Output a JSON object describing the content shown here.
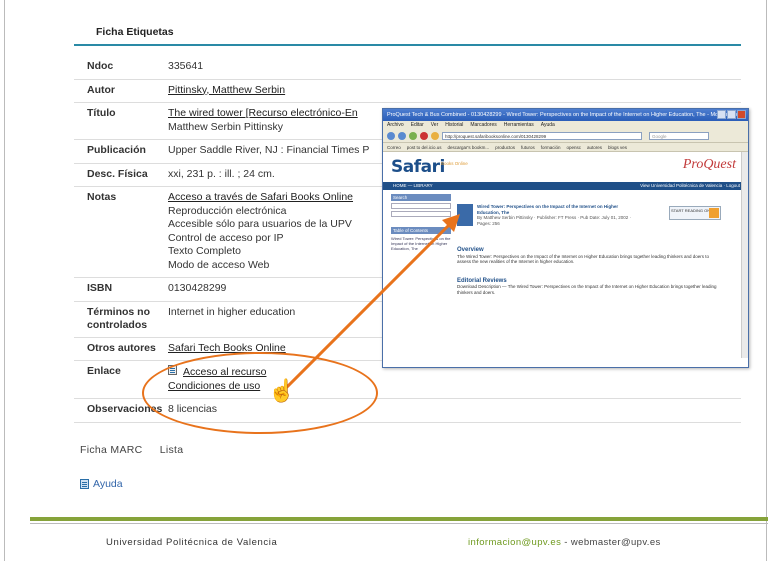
{
  "ficha": {
    "title": "Ficha Etiquetas"
  },
  "record": [
    {
      "key": "Ndoc",
      "values": [
        "335641"
      ],
      "link": [
        false
      ]
    },
    {
      "key": "Autor",
      "values": [
        "Pittinsky, Matthew Serbin"
      ],
      "link": [
        true
      ]
    },
    {
      "key": "Título",
      "values": [
        "The wired tower [Recurso electrónico-En",
        "Matthew Serbin Pittinsky"
      ],
      "link": [
        true,
        false
      ]
    },
    {
      "key": "Publicación",
      "values": [
        "Upper Saddle River, NJ : Financial Times P"
      ],
      "link": [
        false
      ]
    },
    {
      "key": "Desc. Física",
      "values": [
        "xxi, 231 p. : ill. ; 24 cm."
      ],
      "link": [
        false
      ]
    },
    {
      "key": "Notas",
      "values": [
        "Acceso a través de Safari Books Online",
        "Reproducción electrónica",
        "Accesible sólo para usuarios de la UPV",
        "Control de acceso por IP",
        "Texto Completo",
        "Modo de acceso Web"
      ],
      "link": [
        true,
        false,
        false,
        false,
        false,
        false
      ]
    },
    {
      "key": "ISBN",
      "values": [
        "0130428299"
      ],
      "link": [
        false
      ]
    },
    {
      "key": "Términos no controlados",
      "values": [
        "Internet in higher education"
      ],
      "link": [
        false
      ]
    },
    {
      "key": "Otros autores",
      "values": [
        "Safari Tech Books Online"
      ],
      "link": [
        true
      ]
    },
    {
      "key": "Enlace",
      "values": [
        "Acceso al recurso",
        "Condiciones de uso"
      ],
      "link": [
        true,
        true
      ]
    },
    {
      "key": "Observaciones",
      "values": [
        "8 licencias"
      ],
      "link": [
        false
      ]
    }
  ],
  "bottom_links": {
    "marc": "Ficha MARC",
    "lista": "Lista",
    "ayuda": "Ayuda"
  },
  "footer": {
    "university": "Universidad Politécnica de Valencia",
    "email1": "informacion@upv.es",
    "separator": " - ",
    "email2": "webmaster@upv.es"
  },
  "browser": {
    "title": "ProQuest Tech & Bus Combined - 0130428299 - Wired Tower: Perspectives on the Impact of the Internet on Higher Education, The - Mozilla Firefox",
    "menu": [
      "Archivo",
      "Editar",
      "Ver",
      "Historial",
      "Marcadores",
      "Herramientas",
      "Ayuda"
    ],
    "url": "http://proquest.safaribooksonline.com/0130428299",
    "search_placeholder": "Google",
    "bookmarks": [
      "Correo",
      "post to del.icio.us",
      "descargar's bookm...",
      "productos",
      "futuros",
      "formación",
      "opensc",
      "autores",
      "blogs ves"
    ],
    "logo": "Safari",
    "logo_sub": "Books Online",
    "brand": "ProQuest",
    "nav_left": "HOME  —  LIBRARY",
    "nav_right": "View Universidad Politécnica de Valencia  ·  Logout",
    "search_head": "Search",
    "toc_head": "Table of Contents",
    "book_title": "Wired Tower: Perspectives on the Impact of the Internet on Higher Education, The",
    "book_meta": "By Matthew Serbin Pittinsky · Publisher: FT Press · Pub Date: July 01, 2002 · Pages: 256",
    "start_reading": "START READING ONLINE",
    "overview_head": "Overview",
    "overview_text": "The Wired Tower: Perspectives on the Impact of the Internet on Higher Education brings together leading thinkers and doers to assess the new realities of the Internet in higher education.",
    "reviews_head": "Editorial Reviews",
    "review_text": "Download Description — The Wired Tower: Perspectives on the Impact of the Internet on Higher Education brings together leading thinkers and doers."
  }
}
